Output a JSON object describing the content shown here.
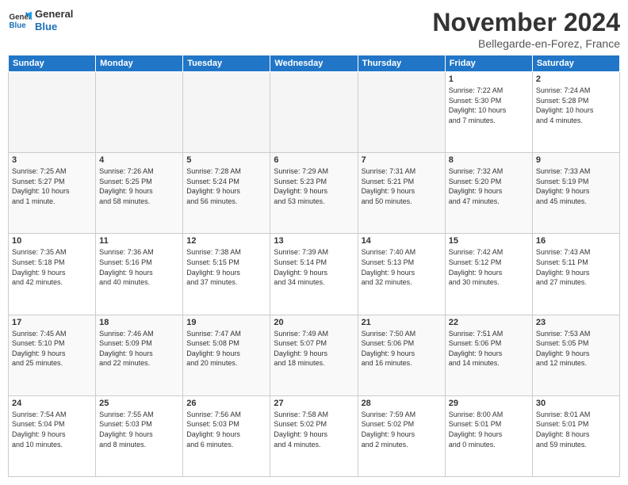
{
  "header": {
    "logo_line1": "General",
    "logo_line2": "Blue",
    "title": "November 2024",
    "location": "Bellegarde-en-Forez, France"
  },
  "days_of_week": [
    "Sunday",
    "Monday",
    "Tuesday",
    "Wednesday",
    "Thursday",
    "Friday",
    "Saturday"
  ],
  "weeks": [
    [
      {
        "day": "",
        "info": ""
      },
      {
        "day": "",
        "info": ""
      },
      {
        "day": "",
        "info": ""
      },
      {
        "day": "",
        "info": ""
      },
      {
        "day": "",
        "info": ""
      },
      {
        "day": "1",
        "info": "Sunrise: 7:22 AM\nSunset: 5:30 PM\nDaylight: 10 hours\nand 7 minutes."
      },
      {
        "day": "2",
        "info": "Sunrise: 7:24 AM\nSunset: 5:28 PM\nDaylight: 10 hours\nand 4 minutes."
      }
    ],
    [
      {
        "day": "3",
        "info": "Sunrise: 7:25 AM\nSunset: 5:27 PM\nDaylight: 10 hours\nand 1 minute."
      },
      {
        "day": "4",
        "info": "Sunrise: 7:26 AM\nSunset: 5:25 PM\nDaylight: 9 hours\nand 58 minutes."
      },
      {
        "day": "5",
        "info": "Sunrise: 7:28 AM\nSunset: 5:24 PM\nDaylight: 9 hours\nand 56 minutes."
      },
      {
        "day": "6",
        "info": "Sunrise: 7:29 AM\nSunset: 5:23 PM\nDaylight: 9 hours\nand 53 minutes."
      },
      {
        "day": "7",
        "info": "Sunrise: 7:31 AM\nSunset: 5:21 PM\nDaylight: 9 hours\nand 50 minutes."
      },
      {
        "day": "8",
        "info": "Sunrise: 7:32 AM\nSunset: 5:20 PM\nDaylight: 9 hours\nand 47 minutes."
      },
      {
        "day": "9",
        "info": "Sunrise: 7:33 AM\nSunset: 5:19 PM\nDaylight: 9 hours\nand 45 minutes."
      }
    ],
    [
      {
        "day": "10",
        "info": "Sunrise: 7:35 AM\nSunset: 5:18 PM\nDaylight: 9 hours\nand 42 minutes."
      },
      {
        "day": "11",
        "info": "Sunrise: 7:36 AM\nSunset: 5:16 PM\nDaylight: 9 hours\nand 40 minutes."
      },
      {
        "day": "12",
        "info": "Sunrise: 7:38 AM\nSunset: 5:15 PM\nDaylight: 9 hours\nand 37 minutes."
      },
      {
        "day": "13",
        "info": "Sunrise: 7:39 AM\nSunset: 5:14 PM\nDaylight: 9 hours\nand 34 minutes."
      },
      {
        "day": "14",
        "info": "Sunrise: 7:40 AM\nSunset: 5:13 PM\nDaylight: 9 hours\nand 32 minutes."
      },
      {
        "day": "15",
        "info": "Sunrise: 7:42 AM\nSunset: 5:12 PM\nDaylight: 9 hours\nand 30 minutes."
      },
      {
        "day": "16",
        "info": "Sunrise: 7:43 AM\nSunset: 5:11 PM\nDaylight: 9 hours\nand 27 minutes."
      }
    ],
    [
      {
        "day": "17",
        "info": "Sunrise: 7:45 AM\nSunset: 5:10 PM\nDaylight: 9 hours\nand 25 minutes."
      },
      {
        "day": "18",
        "info": "Sunrise: 7:46 AM\nSunset: 5:09 PM\nDaylight: 9 hours\nand 22 minutes."
      },
      {
        "day": "19",
        "info": "Sunrise: 7:47 AM\nSunset: 5:08 PM\nDaylight: 9 hours\nand 20 minutes."
      },
      {
        "day": "20",
        "info": "Sunrise: 7:49 AM\nSunset: 5:07 PM\nDaylight: 9 hours\nand 18 minutes."
      },
      {
        "day": "21",
        "info": "Sunrise: 7:50 AM\nSunset: 5:06 PM\nDaylight: 9 hours\nand 16 minutes."
      },
      {
        "day": "22",
        "info": "Sunrise: 7:51 AM\nSunset: 5:06 PM\nDaylight: 9 hours\nand 14 minutes."
      },
      {
        "day": "23",
        "info": "Sunrise: 7:53 AM\nSunset: 5:05 PM\nDaylight: 9 hours\nand 12 minutes."
      }
    ],
    [
      {
        "day": "24",
        "info": "Sunrise: 7:54 AM\nSunset: 5:04 PM\nDaylight: 9 hours\nand 10 minutes."
      },
      {
        "day": "25",
        "info": "Sunrise: 7:55 AM\nSunset: 5:03 PM\nDaylight: 9 hours\nand 8 minutes."
      },
      {
        "day": "26",
        "info": "Sunrise: 7:56 AM\nSunset: 5:03 PM\nDaylight: 9 hours\nand 6 minutes."
      },
      {
        "day": "27",
        "info": "Sunrise: 7:58 AM\nSunset: 5:02 PM\nDaylight: 9 hours\nand 4 minutes."
      },
      {
        "day": "28",
        "info": "Sunrise: 7:59 AM\nSunset: 5:02 PM\nDaylight: 9 hours\nand 2 minutes."
      },
      {
        "day": "29",
        "info": "Sunrise: 8:00 AM\nSunset: 5:01 PM\nDaylight: 9 hours\nand 0 minutes."
      },
      {
        "day": "30",
        "info": "Sunrise: 8:01 AM\nSunset: 5:01 PM\nDaylight: 8 hours\nand 59 minutes."
      }
    ]
  ]
}
